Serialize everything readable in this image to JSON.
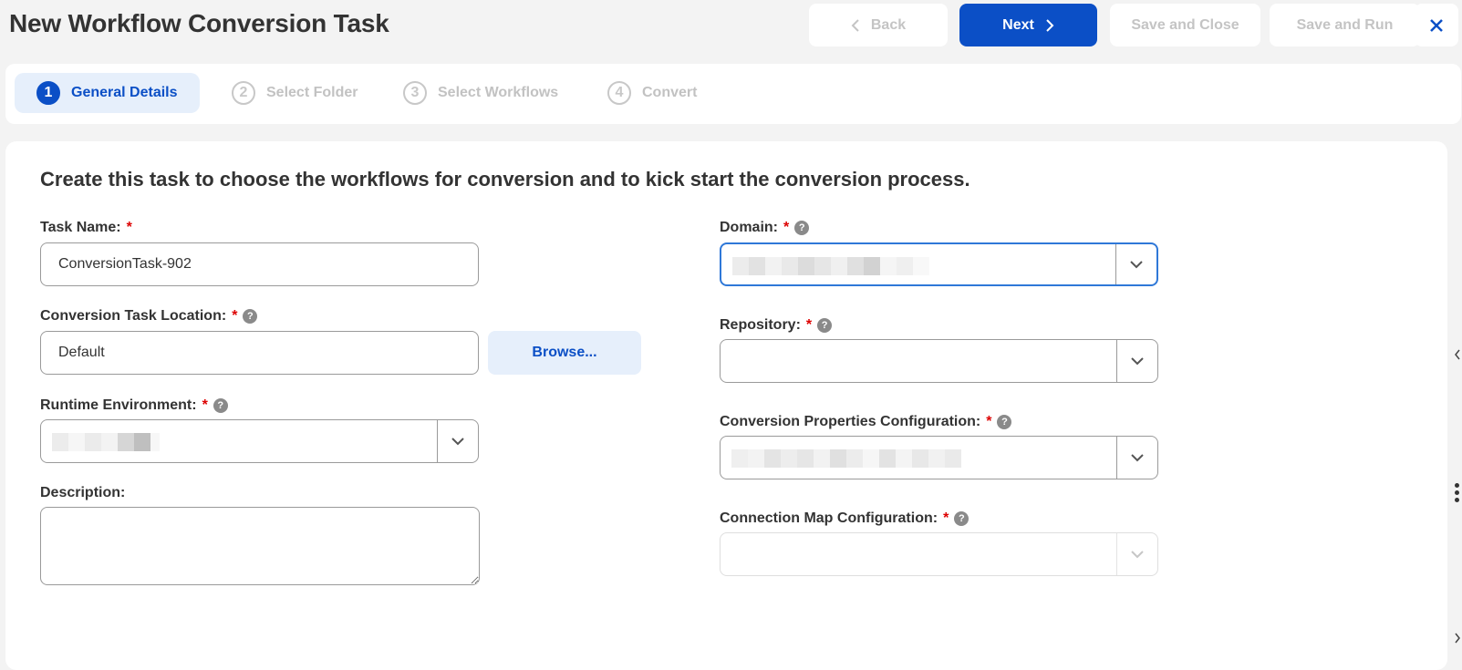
{
  "page": {
    "title": "New Workflow Conversion Task",
    "intro": "Create this task to choose the workflows for conversion and to kick start the conversion process."
  },
  "toolbar": {
    "back_label": "Back",
    "next_label": "Next",
    "save_close_label": "Save and Close",
    "save_run_label": "Save and Run",
    "close_icon": "close-icon"
  },
  "stepper": {
    "steps": [
      {
        "number": "1",
        "label": "General Details",
        "state": "active"
      },
      {
        "number": "2",
        "label": "Select Folder",
        "state": "inactive"
      },
      {
        "number": "3",
        "label": "Select Workflows",
        "state": "inactive"
      },
      {
        "number": "4",
        "label": "Convert",
        "state": "inactive"
      }
    ]
  },
  "form": {
    "task_name": {
      "label": "Task Name:",
      "required_mark": "*",
      "value": "ConversionTask-902"
    },
    "location": {
      "label": "Conversion Task Location:",
      "required_mark": "*",
      "value": "Default",
      "browse_label": "Browse..."
    },
    "runtime": {
      "label": "Runtime Environment:",
      "required_mark": "*",
      "value": ""
    },
    "description": {
      "label": "Description:",
      "value": ""
    },
    "domain": {
      "label": "Domain:",
      "required_mark": "*",
      "value": ""
    },
    "repository": {
      "label": "Repository:",
      "required_mark": "*",
      "value": ""
    },
    "conv_props": {
      "label": "Conversion Properties Configuration:",
      "required_mark": "*",
      "value": ""
    },
    "conn_map": {
      "label": "Connection Map Configuration:",
      "required_mark": "*",
      "value": ""
    }
  },
  "colors": {
    "accent": "#0b4fc6",
    "active_step_bg": "#e6effb",
    "required": "#dd0000"
  }
}
